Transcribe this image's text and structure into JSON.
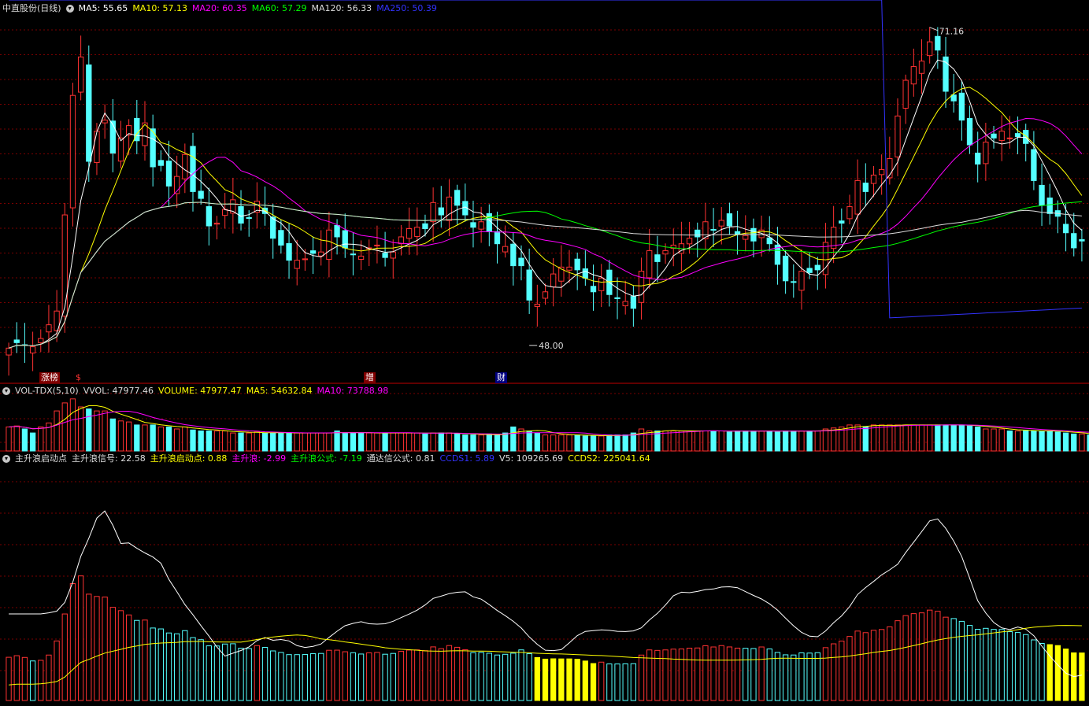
{
  "panel_main": {
    "title": "中直股份(日线)",
    "indicators": [
      {
        "label": "MA5: 55.65",
        "color": "#ffffff"
      },
      {
        "label": "MA10: 57.13",
        "color": "#ffff00"
      },
      {
        "label": "MA20: 60.35",
        "color": "#ff00ff"
      },
      {
        "label": "MA60: 57.29",
        "color": "#00ff00"
      },
      {
        "label": "MA120: 56.33",
        "color": "#dcdcdc"
      },
      {
        "label": "MA250: 50.39",
        "color": "#3333ff"
      }
    ],
    "high_label": "71.16",
    "low_label": "48.00",
    "signals": [
      {
        "text": "涨榜",
        "color": "#ffffff",
        "bg": "#800000"
      },
      {
        "text": "$",
        "color": "#ff3333",
        "bg": "transparent"
      },
      {
        "text": "增",
        "color": "#ffffff",
        "bg": "#800000"
      },
      {
        "text": "财",
        "color": "#ffffff",
        "bg": "#000080"
      }
    ]
  },
  "panel_vol": {
    "title": "VOL-TDX(5,10)",
    "indicators": [
      {
        "label": "VVOL: 47977.46",
        "color": "#dcdcdc"
      },
      {
        "label": "VOLUME: 47977.47",
        "color": "#ffff00"
      },
      {
        "label": "MA5: 54632.84",
        "color": "#ffff00"
      },
      {
        "label": "MA10: 73788.98",
        "color": "#ff00ff"
      }
    ]
  },
  "panel_ind": {
    "title": "主升浪启动点",
    "indicators": [
      {
        "label": "主升浪信号: 22.58",
        "color": "#dcdcdc"
      },
      {
        "label": "主升浪启动点: 0.88",
        "color": "#ffff00"
      },
      {
        "label": "主升浪: -2.99",
        "color": "#ff00ff"
      },
      {
        "label": "主升浪公式: -7.19",
        "color": "#00ff00"
      },
      {
        "label": "通达信公式: 0.81",
        "color": "#dcdcdc"
      },
      {
        "label": "CCDS1: 5.89",
        "color": "#3333ff"
      },
      {
        "label": "V5: 109265.69",
        "color": "#dcdcdc"
      },
      {
        "label": "CCDS2: 225041.64",
        "color": "#ffff00"
      }
    ]
  },
  "chart_data": {
    "type": "candlestick",
    "high": 71.16,
    "low": 48.0,
    "closes": [
      47.8,
      48.2,
      48.0,
      47.9,
      48.5,
      49.5,
      50.5,
      57.5,
      66.2,
      69.0,
      61.4,
      63.6,
      64.4,
      62.0,
      63.1,
      64.0,
      62.9,
      64.2,
      61.0,
      61.1,
      59.6,
      60.3,
      61.9,
      59.2,
      58.7,
      56.7,
      56.9,
      57.9,
      58.6,
      56.9,
      57.3,
      58.5,
      57.6,
      55.8,
      55.3,
      54.2,
      54.2,
      54.3,
      54.7,
      54.8,
      56.4,
      55.9,
      55.1,
      54.6,
      54.5,
      55.1,
      55.3,
      54.4,
      54.8,
      55.9,
      56.5,
      56.6,
      56.5,
      58.4,
      57.5,
      58.8,
      58.2,
      57.5,
      56.6,
      57.0,
      56.3,
      55.4,
      55.2,
      53.8,
      53.8,
      51.3,
      51.0,
      51.9,
      53.2,
      53.7,
      53.7,
      53.5,
      52.9,
      51.9,
      52.9,
      51.7,
      51.4,
      51.2,
      50.7,
      53.4,
      54.9,
      54.1,
      54.9,
      55.3,
      55.4,
      55.8,
      55.9,
      57.0,
      56.4,
      57.1,
      56.7,
      56.1,
      56.0,
      55.6,
      56.4,
      55.4,
      53.9,
      52.7,
      52.6,
      53.4,
      53.3,
      53.5,
      55.5,
      56.6,
      56.9,
      58.1,
      60.0,
      59.2,
      60.4,
      60.8,
      61.6,
      64.7,
      67.3,
      68.3,
      68.7,
      70.1,
      69.5,
      66.5,
      65.8,
      64.4,
      62.6,
      61.2,
      62.8,
      63.1,
      63.6,
      63.1,
      63.2,
      62.7,
      60.0,
      58.2,
      57.6,
      57.4,
      56.2,
      55.1,
      55.6
    ],
    "volume": [
      24,
      25,
      22,
      18,
      24,
      28,
      40,
      48,
      52,
      44,
      42,
      40,
      40,
      32,
      30,
      29,
      26,
      26,
      26,
      24,
      24,
      22,
      24,
      21,
      20,
      20,
      20,
      20,
      18,
      18,
      18,
      19,
      18,
      18,
      18,
      18,
      18,
      18,
      18,
      18,
      18,
      20,
      18,
      18,
      18,
      18,
      18,
      18,
      18,
      18,
      18,
      18,
      17,
      18,
      18,
      18,
      17,
      16,
      16,
      16,
      17,
      16,
      18,
      24,
      22,
      20,
      18,
      16,
      16,
      16,
      16,
      16,
      15,
      15,
      15,
      16,
      16,
      16,
      18,
      22,
      20,
      20,
      20,
      20,
      20,
      20,
      20,
      20,
      20,
      20,
      19,
      20,
      20,
      20,
      20,
      20,
      19,
      20,
      20,
      20,
      20,
      20,
      22,
      23,
      24,
      26,
      26,
      24,
      26,
      26,
      26,
      26,
      26,
      26,
      26,
      26,
      26,
      26,
      26,
      26,
      25,
      24,
      22,
      22,
      22,
      20,
      20,
      20,
      20,
      20,
      20,
      19,
      18,
      17,
      17,
      16
    ]
  }
}
